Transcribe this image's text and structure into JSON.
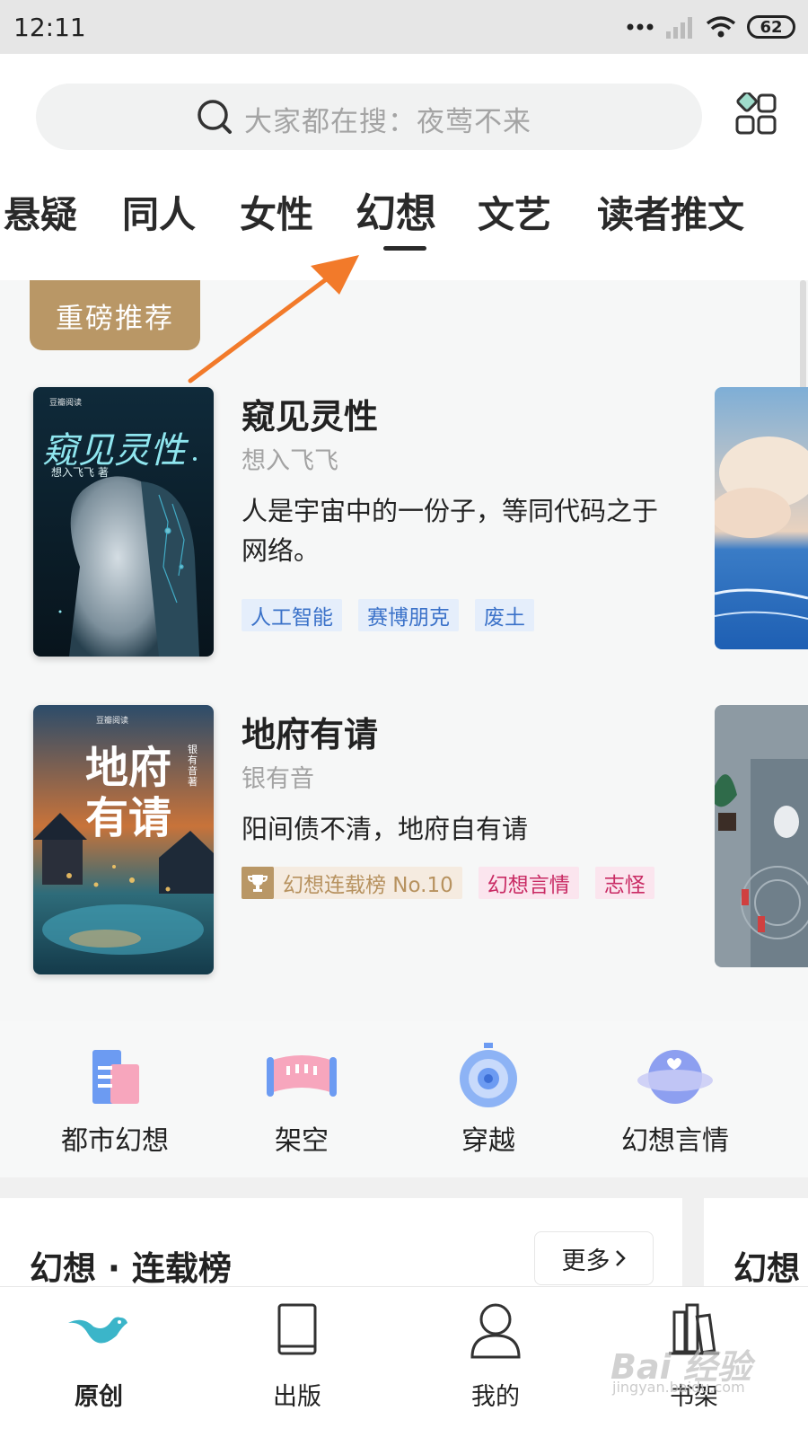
{
  "status_bar": {
    "time": "12:11",
    "battery": "62",
    "icons": [
      "dots-icon",
      "signal-icon",
      "wifi-icon",
      "battery-icon"
    ]
  },
  "search": {
    "placeholder": "大家都在搜：夜莺不来"
  },
  "tabs": [
    {
      "label": "悬疑"
    },
    {
      "label": "同人"
    },
    {
      "label": "女性"
    },
    {
      "label": "幻想",
      "active": true
    },
    {
      "label": "文艺"
    },
    {
      "label": "读者推文"
    }
  ],
  "featured": {
    "badge": "重磅推荐",
    "books": [
      {
        "title": "窥见灵性",
        "author": "想入飞飞",
        "description": "人是宇宙中的一份子，等同代码之于网络。",
        "cover_title": "窥见灵性",
        "cover_author": "想入飞飞 著",
        "cover_brand": "豆瓣阅读",
        "tags": [
          "人工智能",
          "赛博朋克",
          "废土"
        ]
      },
      {
        "title": "地府有请",
        "author": "银有音",
        "description": "阳间债不清，地府自有请",
        "cover_title": "地府有请",
        "cover_author": "银有音 著",
        "cover_brand": "豆瓣阅读",
        "rank": "幻想连载榜 No.10",
        "tags": [
          "幻想言情",
          "志怪"
        ]
      }
    ]
  },
  "categories": [
    {
      "label": "都市幻想",
      "icon": "building-icon"
    },
    {
      "label": "架空",
      "icon": "scroll-icon"
    },
    {
      "label": "穿越",
      "icon": "portal-icon"
    },
    {
      "label": "幻想言情",
      "icon": "planet-icon"
    }
  ],
  "ranking": {
    "title": "幻想 · 连载榜",
    "more": "更多",
    "next_title": "幻想"
  },
  "bottom_nav": [
    {
      "label": "原创",
      "active": true,
      "icon": "bird-icon"
    },
    {
      "label": "出版",
      "icon": "book-icon"
    },
    {
      "label": "我的",
      "icon": "profile-icon"
    },
    {
      "label": "书架",
      "icon": "bookshelf-icon"
    }
  ],
  "watermark": {
    "text": "Bai 经验",
    "sub": "jingyan.baidu.com"
  },
  "colors": {
    "accent_gold": "#b99766",
    "arrow": "#f27a2a",
    "tag_blue": "#3b72c9",
    "tag_pink": "#c92b64"
  }
}
